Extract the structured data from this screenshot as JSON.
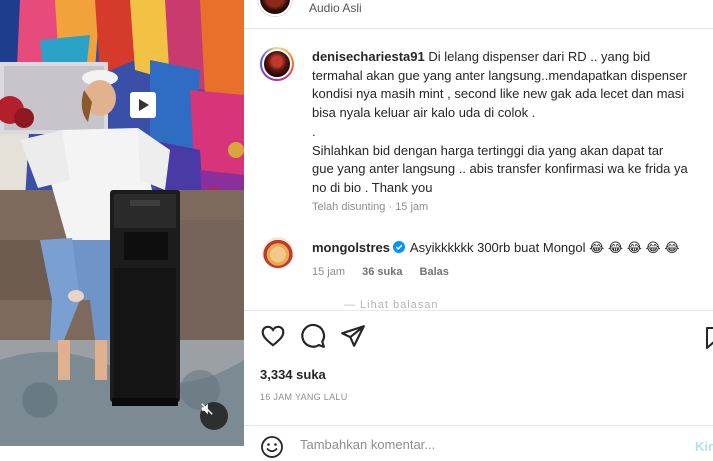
{
  "audio": {
    "label": "Audio Asli"
  },
  "caption": {
    "username": "denisechariesta91",
    "text": "Di lelang dispenser dari RD .. yang bid\ntermahal akan gue yang anter langsung..mendapatkan dispenser\nkondisi nya masih mint , second like new gak ada lecet dan masi\nbisa nyala keluar air kalo uda di colok .\n.\nSihlahkan bid dengan harga tertinggi dia yang akan dapat tar\ngue yang anter langsung .. abis transfer konfirmasi wa ke frida ya\nno di bio . Thank you",
    "edited": "Telah disunting",
    "age": "15 jam"
  },
  "comment": {
    "username": "mongolstres",
    "text": "Asyikkkkkk 300rb buat Mongol 😂 😂 😂 😂 😂",
    "age": "15 jam",
    "likes": "36 suka",
    "reply": "Balas"
  },
  "post": {
    "likes": "3,334 suka",
    "time": "16 JAM YANG LALU"
  },
  "comment_box": {
    "placeholder": "Tambahkan komentar...",
    "post_label": "Kirim"
  },
  "icons": {
    "like": "heart-icon",
    "comment": "comment-icon",
    "share": "send-icon",
    "save": "bookmark-icon",
    "mute": "muted-speaker-icon",
    "emoji": "emoji-icon",
    "verified": "verified-badge-icon"
  },
  "colors": {
    "verified": "#0095f6",
    "post_button_disabled": "#b2dffc",
    "muted_text": "#8e8e8e"
  }
}
